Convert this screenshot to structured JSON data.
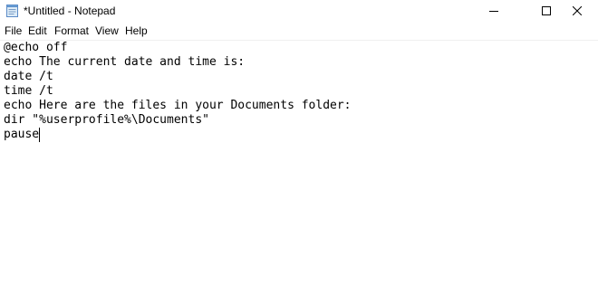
{
  "window": {
    "title": "*Untitled - Notepad",
    "app_icon": "notepad-icon"
  },
  "caption_buttons": {
    "minimize_icon": "minimize-icon",
    "maximize_icon": "maximize-icon",
    "close_icon": "close-icon"
  },
  "menu": {
    "items": [
      {
        "label": "File"
      },
      {
        "label": "Edit"
      },
      {
        "label": "Format"
      },
      {
        "label": "View"
      },
      {
        "label": "Help"
      }
    ]
  },
  "editor": {
    "lines": [
      "@echo off",
      "echo The current date and time is:",
      "date /t",
      "time /t",
      "echo Here are the files in your Documents folder:",
      "dir \"%userprofile%\\Documents\"",
      "pause"
    ]
  }
}
